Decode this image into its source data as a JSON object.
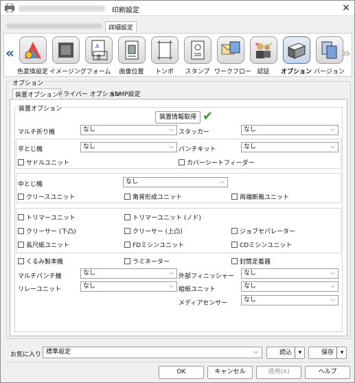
{
  "window": {
    "title": "印刷設定",
    "close_glyph": "✕"
  },
  "tabs_top": {
    "detail_tab": "詳細設定"
  },
  "ribbon": {
    "items": [
      {
        "label": "色変換設定",
        "icon": "color-conversion-icon"
      },
      {
        "label": "イメージング",
        "icon": "imaging-icon"
      },
      {
        "label": "フォーム",
        "icon": "form-icon"
      },
      {
        "label": "画像位置",
        "icon": "image-position-icon"
      },
      {
        "label": "トンボ",
        "icon": "crop-marks-icon"
      },
      {
        "label": "スタンプ",
        "icon": "stamp-icon"
      },
      {
        "label": "ワークフロー",
        "icon": "workflow-icon"
      },
      {
        "label": "認証",
        "icon": "authentication-icon"
      },
      {
        "label": "オプション",
        "icon": "option-icon"
      },
      {
        "label": "バージョン",
        "icon": "version-icon"
      }
    ],
    "active_index": 8
  },
  "option_group": {
    "title": "オプション",
    "tabs": [
      "装置オプション",
      "ドライバー オプション",
      "SNMP設定"
    ],
    "panel_legend": "装置オプション",
    "get_info_button": "装置情報取得",
    "fields": {
      "multi_fold_label": "マルチ折り機",
      "multi_fold_value": "なし",
      "stacker_label": "スタッカー",
      "stacker_value": "なし",
      "flat_stitch_label": "平とじ機",
      "flat_stitch_value": "なし",
      "punch_kit_label": "パンチキット",
      "punch_kit_value": "なし",
      "saddle_unit_label": "サドルユニット",
      "cover_sheet_feeder_label": "カバーシートフィーダー",
      "saddle_stitch_label": "中とじ機",
      "saddle_stitch_value": "なし",
      "crease_unit_label": "クリースユニット",
      "square_fold_label": "角背形成ユニット",
      "dual_trim_label": "両端断裁ユニット",
      "trimmer_label": "トリマーユニット",
      "trimmer_nd_label": "トリマーユニット (ノド)",
      "creaser_down_label": "クリーサー (下凸)",
      "creaser_up_label": "クリーサー (上凸)",
      "job_separator_label": "ジョブセパレーター",
      "long_paper_label": "長尺紙ユニット",
      "fd_perf_label": "FDミシンユニット",
      "cd_perf_label": "CDミシンユニット",
      "perfect_binder_label": "くるみ製本機",
      "laminator_label": "ラミネーター",
      "sealer_label": "封筒定着器",
      "multi_punch_label": "マルチパンチ機",
      "multi_punch_value": "なし",
      "external_finisher_label": "外部フィニッシャー",
      "external_finisher_value": "なし",
      "relay_unit_label": "リレーユニット",
      "relay_unit_value": "なし",
      "paper_feed_unit_label": "給紙ユニット",
      "paper_feed_unit_value": "なし",
      "media_sensor_label": "メディアセンサー",
      "media_sensor_value": "なし"
    }
  },
  "favorites": {
    "label": "お気に入り",
    "value": "標準設定",
    "load_button": "読込",
    "save_button": "保存"
  },
  "dialog_buttons": {
    "ok": "OK",
    "cancel": "キャンセル",
    "apply": "適用(A)",
    "help": "ヘルプ"
  }
}
